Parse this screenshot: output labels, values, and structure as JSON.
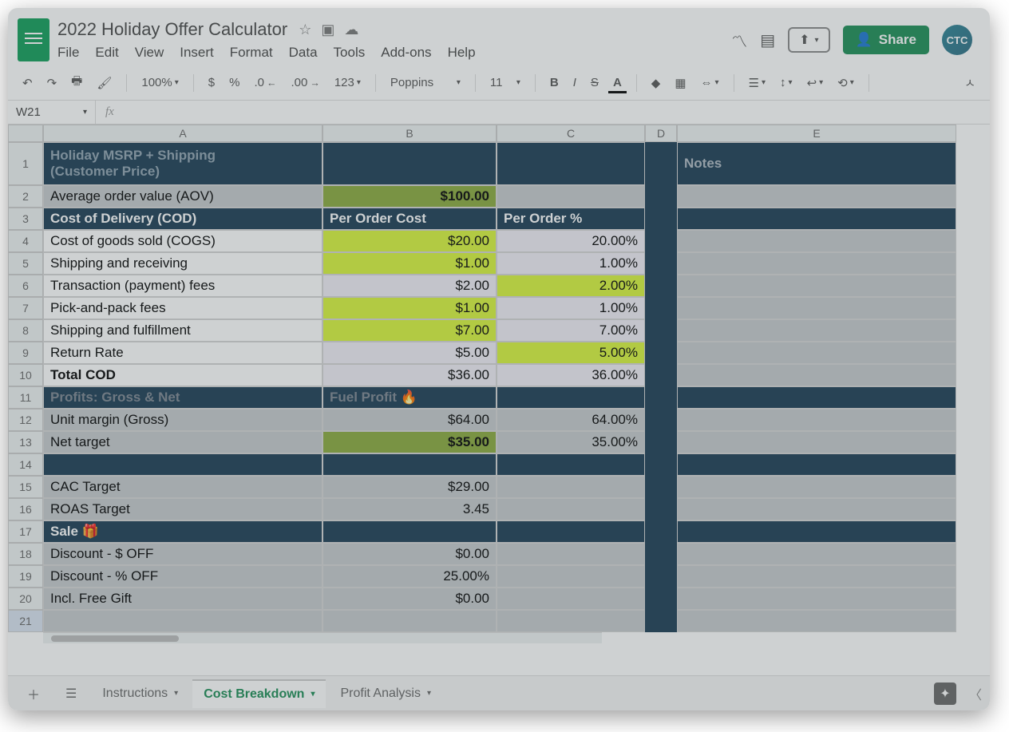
{
  "doc": {
    "title": "2022 Holiday Offer Calculator"
  },
  "menu": {
    "file": "File",
    "edit": "Edit",
    "view": "View",
    "insert": "Insert",
    "format": "Format",
    "data": "Data",
    "tools": "Tools",
    "addons": "Add-ons",
    "help": "Help"
  },
  "share": "Share",
  "avatar": "CTC",
  "toolbar": {
    "zoom": "100%",
    "currency": "$",
    "percent": "%",
    "dec_dec": ".0",
    "dec_inc": ".00",
    "num_fmt": "123",
    "font": "Poppins",
    "size": "11"
  },
  "namebox": "W21",
  "fx": "fx",
  "cols": {
    "A": "A",
    "B": "B",
    "C": "C",
    "D": "D",
    "E": "E"
  },
  "rows": [
    "1",
    "2",
    "3",
    "4",
    "5",
    "6",
    "7",
    "8",
    "9",
    "10",
    "11",
    "12",
    "13",
    "14",
    "15",
    "16",
    "17",
    "18",
    "19",
    "20",
    "21"
  ],
  "section1": {
    "title_l1": "Holiday MSRP + Shipping",
    "title_l2": "(Customer Price)",
    "notes": "Notes",
    "aov_label": "Average order value (AOV)",
    "aov_value": "$100.00"
  },
  "cod": {
    "header": "Cost of Delivery (COD)",
    "col_b": "Per Order Cost",
    "col_c": "Per Order %",
    "rows": [
      {
        "label": "Cost of goods sold (COGS)",
        "cost": "$20.00",
        "pct": "20.00%",
        "cost_hl": true,
        "pct_hl": false
      },
      {
        "label": "Shipping and receiving",
        "cost": "$1.00",
        "pct": "1.00%",
        "cost_hl": true,
        "pct_hl": false
      },
      {
        "label": "Transaction (payment) fees",
        "cost": "$2.00",
        "pct": "2.00%",
        "cost_hl": false,
        "pct_hl": true
      },
      {
        "label": "Pick-and-pack fees",
        "cost": "$1.00",
        "pct": "1.00%",
        "cost_hl": true,
        "pct_hl": false
      },
      {
        "label": "Shipping and fulfillment",
        "cost": "$7.00",
        "pct": "7.00%",
        "cost_hl": true,
        "pct_hl": false
      },
      {
        "label": "Return Rate",
        "cost": "$5.00",
        "pct": "5.00%",
        "cost_hl": false,
        "pct_hl": true
      }
    ],
    "total_label": "Total COD",
    "total_cost": "$36.00",
    "total_pct": "36.00%"
  },
  "profits": {
    "header": "Profits: Gross & Net",
    "col_b": "Fuel Profit 🔥",
    "unit_label": "Unit margin (Gross)",
    "unit_cost": "$64.00",
    "unit_pct": "64.00%",
    "net_label": "Net target",
    "net_cost": "$35.00",
    "net_pct": "35.00%"
  },
  "targets": {
    "cac_label": "CAC Target",
    "cac_value": "$29.00",
    "roas_label": "ROAS Target",
    "roas_value": "3.45"
  },
  "sale": {
    "header": "Sale 🎁",
    "doff_label": "Discount - $ OFF",
    "doff_value": "$0.00",
    "poff_label": "Discount - % OFF",
    "poff_value": "25.00%",
    "gift_label": "Incl. Free Gift",
    "gift_value": "$0.00"
  },
  "tabs": {
    "t1": "Instructions",
    "t2": "Cost Breakdown",
    "t3": "Profit Analysis"
  },
  "chart_data": {
    "type": "table",
    "title": "2022 Holiday Offer Calculator — Cost Breakdown",
    "aov": 100.0,
    "cod_items": [
      {
        "name": "Cost of goods sold (COGS)",
        "per_order_cost": 20.0,
        "per_order_pct": 20.0
      },
      {
        "name": "Shipping and receiving",
        "per_order_cost": 1.0,
        "per_order_pct": 1.0
      },
      {
        "name": "Transaction (payment) fees",
        "per_order_cost": 2.0,
        "per_order_pct": 2.0
      },
      {
        "name": "Pick-and-pack fees",
        "per_order_cost": 1.0,
        "per_order_pct": 1.0
      },
      {
        "name": "Shipping and fulfillment",
        "per_order_cost": 7.0,
        "per_order_pct": 7.0
      },
      {
        "name": "Return Rate",
        "per_order_cost": 5.0,
        "per_order_pct": 5.0
      }
    ],
    "total_cod": {
      "per_order_cost": 36.0,
      "per_order_pct": 36.0
    },
    "unit_margin_gross": {
      "value": 64.0,
      "pct": 64.0
    },
    "net_target": {
      "value": 35.0,
      "pct": 35.0
    },
    "cac_target": 29.0,
    "roas_target": 3.45,
    "discount_dollar_off": 0.0,
    "discount_pct_off": 25.0,
    "free_gift": 0.0
  }
}
